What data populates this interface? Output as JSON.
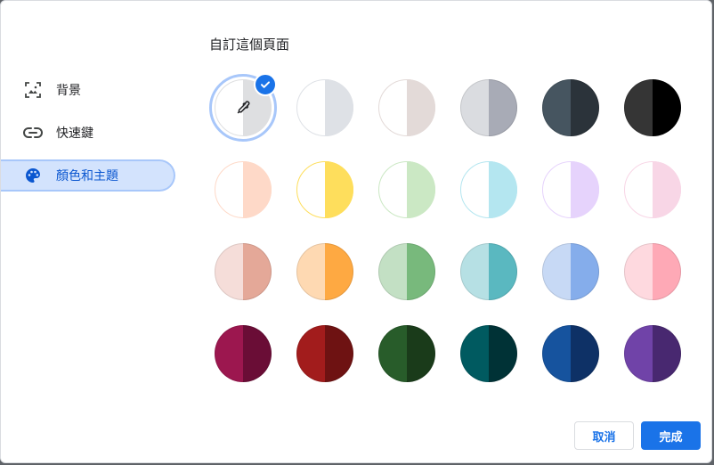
{
  "sidebar": {
    "items": [
      {
        "label": "背景",
        "icon": "image-icon",
        "selected": false
      },
      {
        "label": "快速鍵",
        "icon": "link-icon",
        "selected": false
      },
      {
        "label": "顏色和主題",
        "icon": "palette-icon",
        "selected": true
      }
    ]
  },
  "main": {
    "title": "自訂這個頁面",
    "swatches": [
      [
        {
          "left": "#ffffff",
          "right": "#dedfe1",
          "selected": true,
          "custom": true,
          "icon": "eyedropper-icon"
        },
        {
          "left": "#ffffff",
          "right": "#dee1e6"
        },
        {
          "left": "#ffffff",
          "right": "#e3dad8"
        },
        {
          "left": "#dadce0",
          "right": "#a8abb6"
        },
        {
          "left": "#465560",
          "right": "#2b333a"
        },
        {
          "left": "#353535",
          "right": "#000000"
        }
      ],
      [
        {
          "left": "#ffffff",
          "right": "#fed9c8"
        },
        {
          "left": "#ffffff",
          "right": "#fede5c"
        },
        {
          "left": "#ffffff",
          "right": "#cbe8c4"
        },
        {
          "left": "#ffffff",
          "right": "#b4e6f0"
        },
        {
          "left": "#ffffff",
          "right": "#e6d3fc"
        },
        {
          "left": "#ffffff",
          "right": "#f8d6e6"
        }
      ],
      [
        {
          "left": "#f5ddd9",
          "right": "#e4a898"
        },
        {
          "left": "#fed9b2",
          "right": "#fea942"
        },
        {
          "left": "#c3e0c4",
          "right": "#78b97c"
        },
        {
          "left": "#b6e0e4",
          "right": "#5ab8c0"
        },
        {
          "left": "#c7d9f5",
          "right": "#85adeb"
        },
        {
          "left": "#fed9df",
          "right": "#fea9b6"
        }
      ],
      [
        {
          "left": "#9c174f",
          "right": "#6a0d36"
        },
        {
          "left": "#a21c1c",
          "right": "#6e1212"
        },
        {
          "left": "#285c2a",
          "right": "#1a3b1a"
        },
        {
          "left": "#005a60",
          "right": "#003236"
        },
        {
          "left": "#16539e",
          "right": "#0e3166"
        },
        {
          "left": "#7043a8",
          "right": "#482870"
        }
      ]
    ],
    "check_icon": "check-icon"
  },
  "footer": {
    "cancel_label": "取消",
    "done_label": "完成"
  },
  "colors": {
    "accent": "#1a73e8",
    "selected_bg": "#d3e3fd"
  }
}
